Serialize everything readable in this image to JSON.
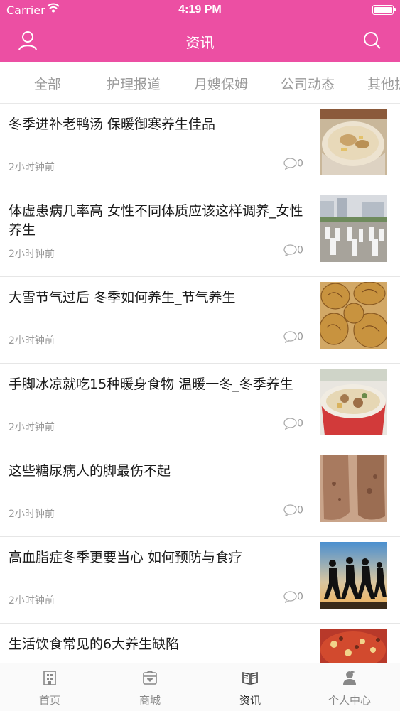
{
  "status_bar": {
    "carrier": "Carrier",
    "time": "4:19 PM"
  },
  "header": {
    "title": "资讯",
    "user_icon": "user-icon",
    "search_icon": "search-icon",
    "color": "#ec4fa3"
  },
  "tabs": [
    "全部",
    "护理报道",
    "月嫂保姆",
    "公司动态",
    "其他护"
  ],
  "articles": [
    {
      "title": "冬季进补老鸭汤 保暖御寒养生佳品",
      "time": "2小时钟前",
      "comments": "0"
    },
    {
      "title": "体虚患病几率高 女性不同体质应该这样调养_女性养生",
      "time": "2小时钟前",
      "comments": "0"
    },
    {
      "title": "大雪节气过后 冬季如何养生_节气养生",
      "time": "2小时钟前",
      "comments": "0"
    },
    {
      "title": "手脚冰凉就吃15种暖身食物 温暖一冬_冬季养生",
      "time": "2小时钟前",
      "comments": "0"
    },
    {
      "title": "这些糖尿病人的脚最伤不起",
      "time": "2小时钟前",
      "comments": "0"
    },
    {
      "title": "高血脂症冬季更要当心 如何预防与食疗",
      "time": "2小时钟前",
      "comments": "0"
    },
    {
      "title": "生活饮食常见的6大养生缺陷",
      "time": "",
      "comments": ""
    }
  ],
  "tabbar": [
    {
      "label": "首页",
      "icon": "home-icon"
    },
    {
      "label": "商城",
      "icon": "shop-icon"
    },
    {
      "label": "资讯",
      "icon": "news-book-icon",
      "active": true
    },
    {
      "label": "个人中心",
      "icon": "profile-icon"
    }
  ]
}
